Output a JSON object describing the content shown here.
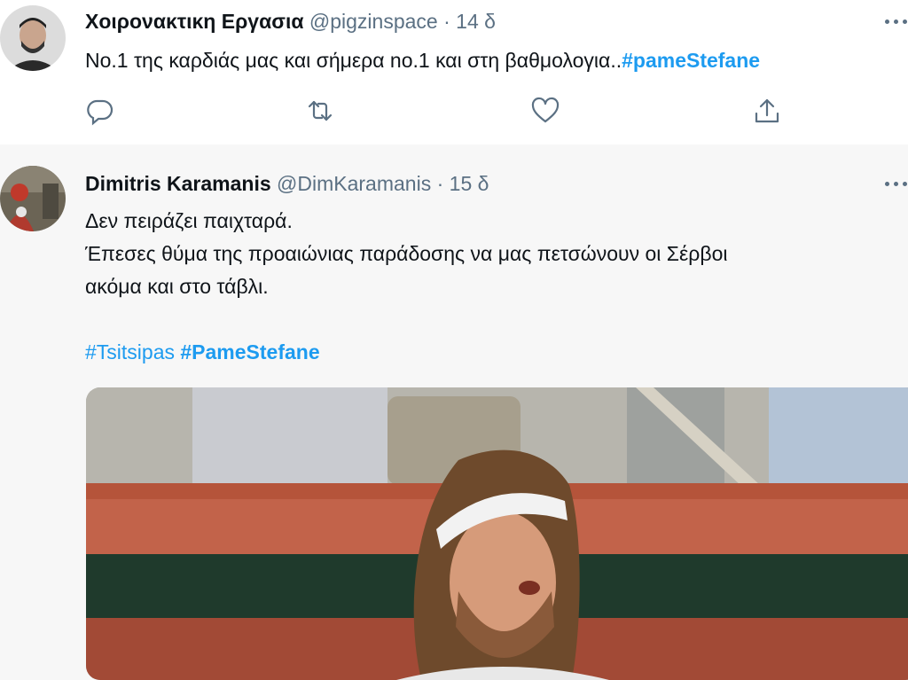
{
  "tweets": [
    {
      "name": "Χοιρονακτικη Εργασια",
      "handle": "@pigzinspace",
      "separator": "·",
      "time": "14 δ",
      "text_lead": "No.1 της καρδιάς μας και σήμερα no.1 και στη βαθμολογια..",
      "hashtag": "#pameStefane",
      "actions": [
        "reply-icon",
        "retweet-icon",
        "like-icon",
        "share-icon"
      ]
    },
    {
      "name": "Dimitris Karamanis",
      "handle": "@DimKaramanis",
      "separator": "·",
      "time": "15 δ",
      "lines": [
        "Δεν πειράζει παιχταρά.",
        "Έπεσες θύμα της προαιώνιας παράδοσης να μας πετσώνουν οι Σέρβοι",
        "ακόμα και στο τάβλι."
      ],
      "hashtags": [
        "#Tsitsipas",
        "#PameStefane"
      ],
      "media": "tennis-player-photo"
    }
  ],
  "colors": {
    "link": "#1d9bf0",
    "secondary": "#5b7083",
    "text": "#0f1419"
  }
}
